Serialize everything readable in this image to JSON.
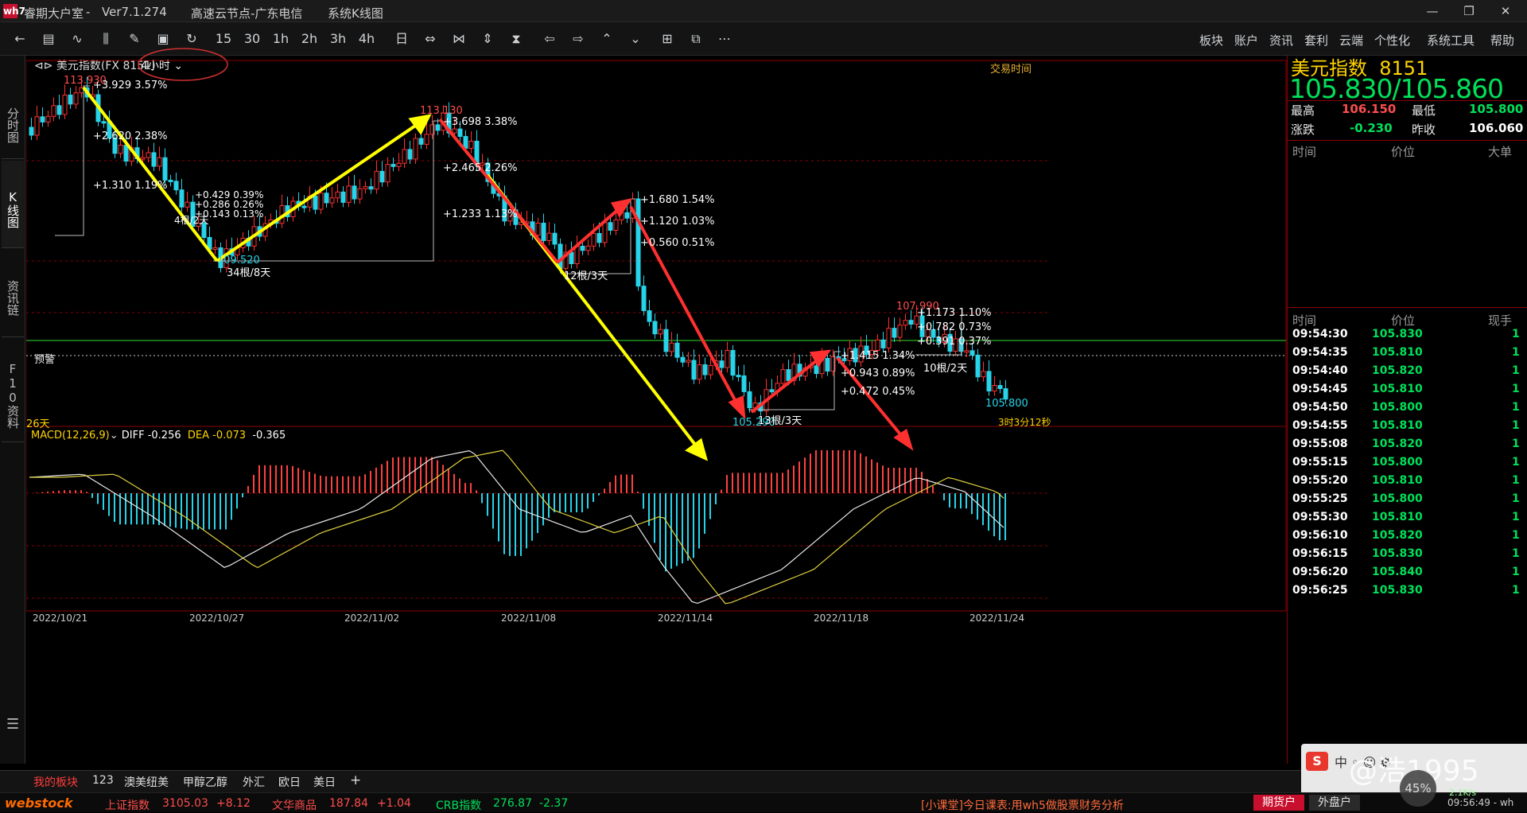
{
  "title_bar": {
    "app": "睿期大户室",
    "version": "Ver7.1.274",
    "node": "高速云节点-广东电信",
    "view": "系统K线图",
    "logo": "wh7"
  },
  "toolbar": {
    "timeframes": [
      "15",
      "30",
      "1h",
      "2h",
      "3h",
      "4h"
    ],
    "right_menu": [
      "板块",
      "账户",
      "资讯",
      "套利",
      "云端",
      "个性化",
      "系统工具",
      "帮助"
    ]
  },
  "left_tabs": [
    "分时图",
    "K线图",
    "资讯链",
    "F10资料"
  ],
  "chart_header": {
    "name": "美元指数(FX 8151)",
    "period": "4小时",
    "trade_time": "交易时间"
  },
  "chart_labels": {
    "warn": "预警",
    "days": "26天",
    "countdown": "3时3分12秒"
  },
  "macd": {
    "label": "MACD(12,26,9)",
    "diff": "DIFF -0.256",
    "dea": "DEA -0.073",
    "val": "-0.365"
  },
  "right_panel": {
    "title": "美元指数",
    "code": "8151",
    "bid": "105.830",
    "ask": "105.860",
    "high_label": "最高",
    "high": "106.150",
    "low_label": "最低",
    "low": "105.800",
    "change_label": "涨跌",
    "change": "-0.230",
    "prev_label": "昨收",
    "prev": "106.060",
    "col_time": "时间",
    "col_price": "价位",
    "col_big": "大单",
    "col_vol": "现手",
    "ticks": [
      {
        "t": "09:54:30",
        "p": "105.830",
        "v": "1"
      },
      {
        "t": "09:54:35",
        "p": "105.810",
        "v": "1"
      },
      {
        "t": "09:54:40",
        "p": "105.820",
        "v": "1"
      },
      {
        "t": "09:54:45",
        "p": "105.810",
        "v": "1"
      },
      {
        "t": "09:54:50",
        "p": "105.800",
        "v": "1"
      },
      {
        "t": "09:54:55",
        "p": "105.810",
        "v": "1"
      },
      {
        "t": "09:55:08",
        "p": "105.820",
        "v": "1"
      },
      {
        "t": "09:55:15",
        "p": "105.800",
        "v": "1"
      },
      {
        "t": "09:55:20",
        "p": "105.810",
        "v": "1"
      },
      {
        "t": "09:55:25",
        "p": "105.800",
        "v": "1"
      },
      {
        "t": "09:55:30",
        "p": "105.810",
        "v": "1"
      },
      {
        "t": "09:56:10",
        "p": "105.820",
        "v": "1"
      },
      {
        "t": "09:56:15",
        "p": "105.830",
        "v": "1"
      },
      {
        "t": "09:56:20",
        "p": "105.840",
        "v": "1"
      },
      {
        "t": "09:56:25",
        "p": "105.830",
        "v": "1"
      }
    ]
  },
  "x_dates": [
    "2022/10/21",
    "2022/10/27",
    "2022/11/02",
    "2022/11/08",
    "2022/11/14",
    "2022/11/18",
    "2022/11/24"
  ],
  "bottom_tabs": [
    "我的板块",
    "123",
    "澳美纽美",
    "甲醇乙醇",
    "外汇",
    "欧日",
    "美日",
    "+"
  ],
  "status": {
    "brand": "webstock",
    "idx1_name": "上证指数",
    "idx1_val": "3105.03",
    "idx1_chg": "+8.12",
    "idx2_name": "文华商品",
    "idx2_val": "187.84",
    "idx2_chg": "+1.04",
    "idx3_name": "CRB指数",
    "idx3_val": "276.87",
    "idx3_chg": "-2.37",
    "news": "[小课堂]今日课表:用wh5做股票财务分析",
    "btn1": "期货户",
    "btn2": "外盘户",
    "time": "09:56:49 - wh"
  },
  "overlay": {
    "watermark": "@浩1995",
    "cpu": "45%",
    "net": "2.1K/s"
  },
  "annotations": {
    "price_labels": [
      "113.930",
      "113.130",
      "109.520",
      "107.990",
      "105.290",
      "105.800"
    ],
    "measures": [
      "+3.929  3.57%",
      "+2.620  2.38%",
      "+1.310  1.19%",
      "+3.698  3.38%",
      "+2.465  2.26%",
      "+1.233  1.13%",
      "+1.680  1.54%",
      "+1.120  1.03%",
      "+0.560  0.51%",
      "+1.173  1.10%",
      "+0.782  0.73%",
      "+0.391  0.37%",
      "+1.415  1.34%",
      "+0.943  0.89%",
      "+0.472  0.45%",
      "+0.429  0.39%",
      "+0.286  0.26%",
      "+0.143  0.13%"
    ],
    "bars": [
      "34根/8天",
      "12根/3天",
      "13根/3天",
      "10根/2天",
      "4根/2天"
    ]
  },
  "chart_data": {
    "type": "candlestick",
    "symbol": "美元指数(FX 8151)",
    "period": "4小时",
    "y_levels": [
      113.93,
      113.13,
      109.52,
      107.99,
      105.29,
      105.8
    ],
    "swing_points": [
      {
        "x": "2022/10/21",
        "y": 113.93
      },
      {
        "x": "2022/10/27",
        "y": 109.52
      },
      {
        "x": "2022/11/03",
        "y": 113.13
      },
      {
        "x": "2022/11/08",
        "y": 109.9
      },
      {
        "x": "2022/11/10",
        "y": 111.4
      },
      {
        "x": "2022/11/15",
        "y": 105.29
      },
      {
        "x": "2022/11/18",
        "y": 107.0
      },
      {
        "x": "2022/11/21",
        "y": 107.99
      },
      {
        "x": "2022/11/24",
        "y": 105.8
      }
    ],
    "macd": {
      "diff": -0.256,
      "dea": -0.073,
      "macd": -0.365
    },
    "x_ticks": [
      "2022/10/21",
      "2022/10/27",
      "2022/11/02",
      "2022/11/08",
      "2022/11/14",
      "2022/11/18",
      "2022/11/24"
    ]
  }
}
